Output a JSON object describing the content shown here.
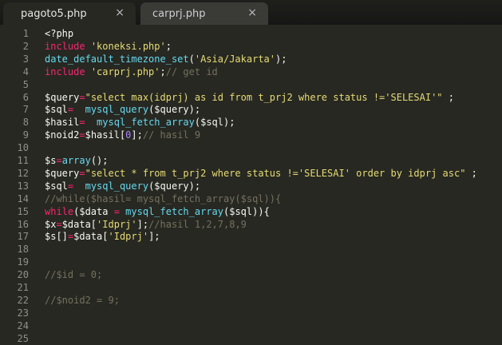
{
  "tabs": [
    {
      "label": "pagoto5.php",
      "close": "×",
      "active": true
    },
    {
      "label": "carprj.php",
      "close": "×",
      "active": false
    }
  ],
  "colors": {
    "background": "#272822",
    "line_number": "#8f908a",
    "text": "#f8f8f2",
    "keyword": "#f92672",
    "string": "#e6db74",
    "function": "#66d9ef",
    "number": "#ae81ff",
    "comment": "#75715e"
  },
  "lines": [
    {
      "n": "1",
      "tokens": [
        [
          "plain",
          "<?php"
        ]
      ]
    },
    {
      "n": "2",
      "tokens": [
        [
          "kw",
          "include"
        ],
        [
          "plain",
          " "
        ],
        [
          "str",
          "'koneksi.php'"
        ],
        [
          "plain",
          ";"
        ]
      ]
    },
    {
      "n": "3",
      "tokens": [
        [
          "fn",
          "date_default_timezone_set"
        ],
        [
          "plain",
          "("
        ],
        [
          "str",
          "'Asia/Jakarta'"
        ],
        [
          "plain",
          ");"
        ]
      ]
    },
    {
      "n": "4",
      "tokens": [
        [
          "kw",
          "include"
        ],
        [
          "plain",
          " "
        ],
        [
          "str",
          "'carprj.php'"
        ],
        [
          "plain",
          ";"
        ],
        [
          "cm",
          "// get id"
        ]
      ]
    },
    {
      "n": "5",
      "tokens": []
    },
    {
      "n": "6",
      "tokens": [
        [
          "plain",
          "$query"
        ],
        [
          "kw",
          "="
        ],
        [
          "str",
          "\"select max(idprj) as id from t_prj2 where status !='SELESAI'\""
        ],
        [
          "plain",
          " ;"
        ]
      ]
    },
    {
      "n": "7",
      "tokens": [
        [
          "plain",
          "$sql"
        ],
        [
          "kw",
          "="
        ],
        [
          "plain",
          "  "
        ],
        [
          "fn",
          "mysql_query"
        ],
        [
          "plain",
          "($query);"
        ]
      ]
    },
    {
      "n": "8",
      "tokens": [
        [
          "plain",
          "$hasil"
        ],
        [
          "kw",
          "="
        ],
        [
          "plain",
          "  "
        ],
        [
          "fn",
          "mysql_fetch_array"
        ],
        [
          "plain",
          "($sql);"
        ]
      ]
    },
    {
      "n": "9",
      "tokens": [
        [
          "plain",
          "$noid2"
        ],
        [
          "kw",
          "="
        ],
        [
          "plain",
          "$hasil["
        ],
        [
          "num",
          "0"
        ],
        [
          "plain",
          "];"
        ],
        [
          "cm",
          "// hasil 9"
        ]
      ]
    },
    {
      "n": "10",
      "tokens": []
    },
    {
      "n": "11",
      "tokens": [
        [
          "plain",
          "$s"
        ],
        [
          "kw",
          "="
        ],
        [
          "fn",
          "array"
        ],
        [
          "plain",
          "();"
        ]
      ]
    },
    {
      "n": "12",
      "tokens": [
        [
          "plain",
          "$query"
        ],
        [
          "kw",
          "="
        ],
        [
          "str",
          "\"select * from t_prj2 where status !='SELESAI' order by idprj asc\""
        ],
        [
          "plain",
          " ;"
        ]
      ]
    },
    {
      "n": "13",
      "tokens": [
        [
          "plain",
          "$sql"
        ],
        [
          "kw",
          "="
        ],
        [
          "plain",
          "  "
        ],
        [
          "fn",
          "mysql_query"
        ],
        [
          "plain",
          "($query);"
        ]
      ]
    },
    {
      "n": "14",
      "tokens": [
        [
          "cm",
          "//while($hasil= mysql_fetch_array($sql)){"
        ]
      ]
    },
    {
      "n": "15",
      "tokens": [
        [
          "kw",
          "while"
        ],
        [
          "plain",
          "($data "
        ],
        [
          "kw",
          "="
        ],
        [
          "plain",
          " "
        ],
        [
          "fn",
          "mysql_fetch_array"
        ],
        [
          "plain",
          "($sql)){"
        ]
      ]
    },
    {
      "n": "16",
      "tokens": [
        [
          "plain",
          "$x"
        ],
        [
          "kw",
          "="
        ],
        [
          "plain",
          "$data["
        ],
        [
          "str",
          "'Idprj'"
        ],
        [
          "plain",
          "];"
        ],
        [
          "cm",
          "//hasil 1,2,7,8,9"
        ]
      ]
    },
    {
      "n": "17",
      "tokens": [
        [
          "plain",
          "$s[]"
        ],
        [
          "kw",
          "="
        ],
        [
          "plain",
          "$data["
        ],
        [
          "str",
          "'Idprj'"
        ],
        [
          "plain",
          "];"
        ]
      ]
    },
    {
      "n": "18",
      "tokens": []
    },
    {
      "n": "19",
      "tokens": []
    },
    {
      "n": "20",
      "tokens": [
        [
          "cm",
          "//$id = 0;"
        ]
      ]
    },
    {
      "n": "21",
      "tokens": []
    },
    {
      "n": "22",
      "tokens": [
        [
          "cm",
          "//$noid2 = 9;"
        ]
      ]
    },
    {
      "n": "23",
      "tokens": []
    },
    {
      "n": "24",
      "tokens": []
    },
    {
      "n": "25",
      "tokens": []
    }
  ]
}
